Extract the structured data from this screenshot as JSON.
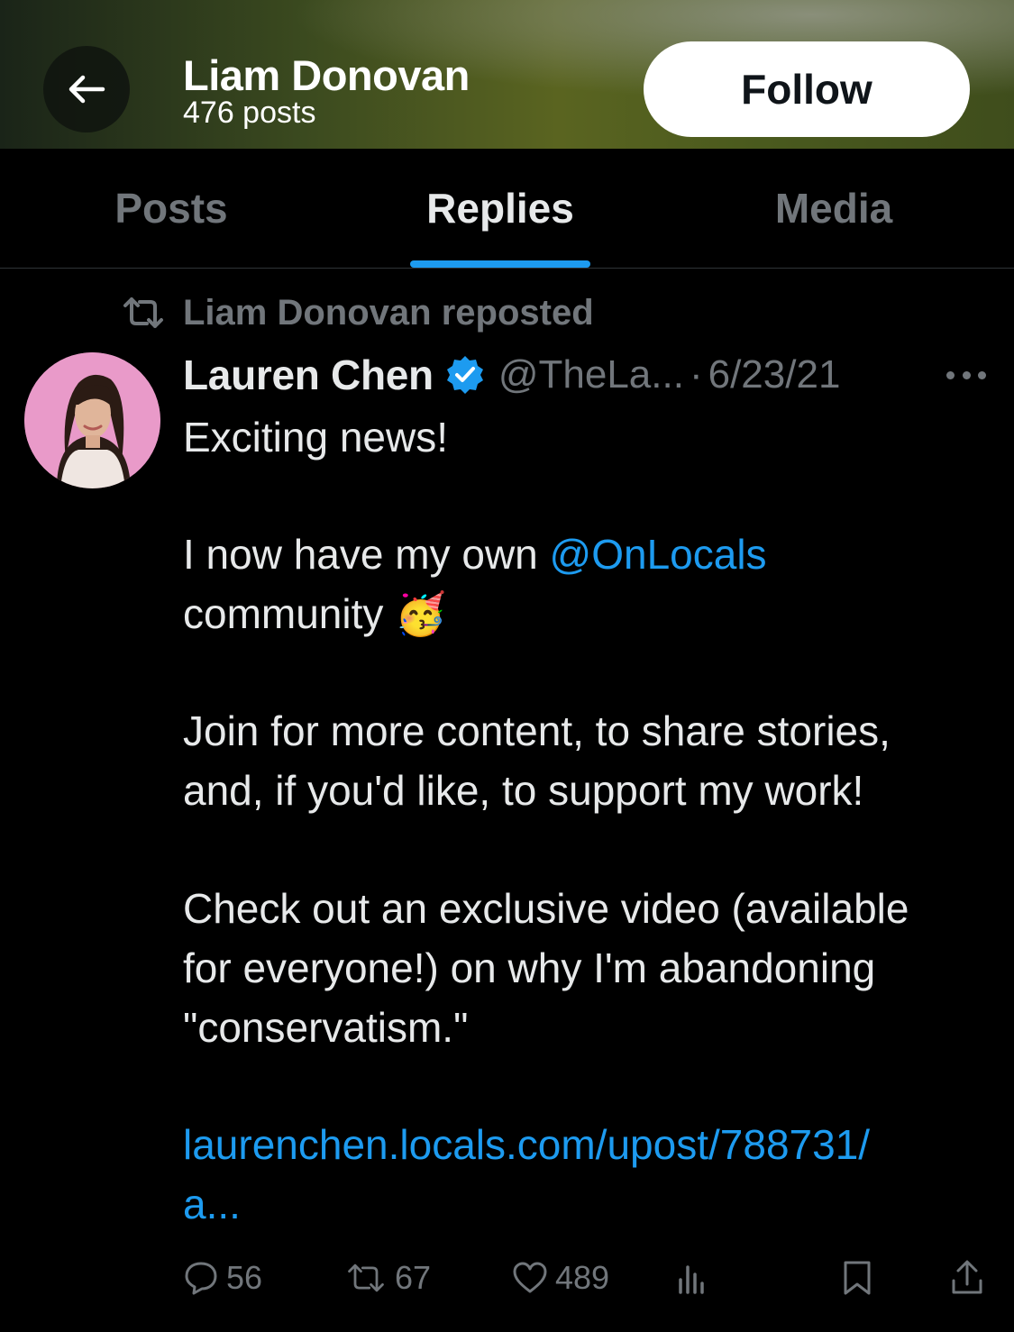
{
  "header": {
    "name": "Liam Donovan",
    "posts_count": "476 posts",
    "follow_label": "Follow"
  },
  "tabs": [
    {
      "label": "Posts",
      "active": false
    },
    {
      "label": "Replies",
      "active": true
    },
    {
      "label": "Media",
      "active": false
    }
  ],
  "post": {
    "repost_label": "Liam Donovan reposted",
    "author_name": "Lauren Chen",
    "handle": "@TheLa...",
    "separator": "·",
    "date": "6/23/21",
    "lines": {
      "l1": "Exciting news!",
      "l2_pre": "I now have my own ",
      "l2_mention": "@OnLocals",
      "l3": "community",
      "l3_emoji": "🥳",
      "l4": "Join for more content, to share stories,",
      "l5": "and, if you'd like, to support my work!",
      "l6": "Check out an exclusive video (available",
      "l7": "for everyone!) on why I'm abandoning",
      "l8": "\"conservatism.\"",
      "link1": "laurenchen.locals.com/upost/788731/",
      "link2": "a..."
    },
    "stats": {
      "replies": "56",
      "reposts": "67",
      "likes": "489"
    }
  },
  "colors": {
    "accent": "#1d9bf0",
    "muted": "#71767b",
    "text": "#e7e9ea",
    "background": "#000000"
  },
  "icons": [
    "back-arrow-icon",
    "repost-icon",
    "verified-badge-icon",
    "more-icon",
    "reply-icon",
    "like-icon",
    "views-icon",
    "bookmark-icon",
    "share-icon"
  ]
}
